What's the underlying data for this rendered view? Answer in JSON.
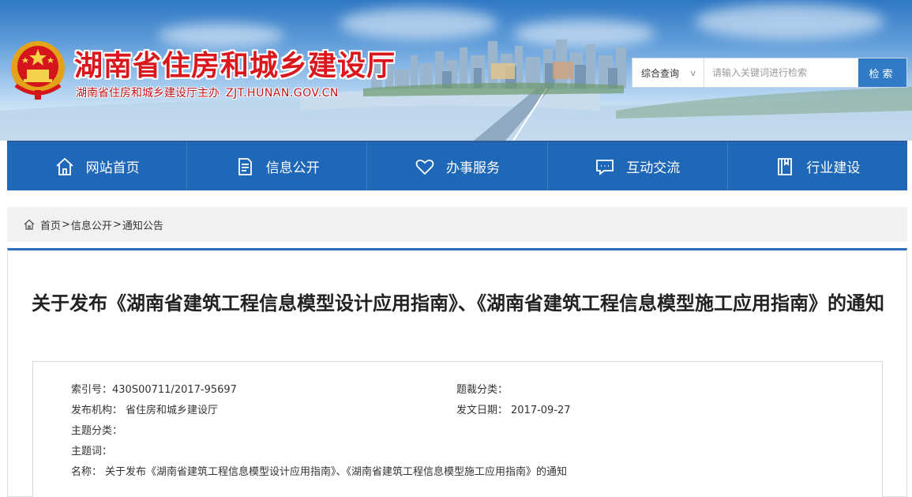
{
  "header": {
    "site_title": "湖南省住房和城乡建设厅",
    "subtitle": "湖南省住房和城乡建设厅主办",
    "domain": "ZJT.HUNAN.GOV.CN"
  },
  "search": {
    "category": "综合查询",
    "category_arrow": "v",
    "placeholder": "请输入关键词进行检索",
    "button": "检索"
  },
  "nav": {
    "items": [
      {
        "label": "网站首页",
        "icon": "home-icon"
      },
      {
        "label": "信息公开",
        "icon": "document-icon"
      },
      {
        "label": "办事服务",
        "icon": "heart-icon"
      },
      {
        "label": "互动交流",
        "icon": "chat-icon"
      },
      {
        "label": "行业建设",
        "icon": "book-icon"
      }
    ]
  },
  "breadcrumb": {
    "items": [
      "首页",
      "信息公开",
      "通知公告"
    ],
    "separator": ">"
  },
  "article": {
    "title": "关于发布《湖南省建筑工程信息模型设计应用指南》、《湖南省建筑工程信息模型施工应用指南》的通知"
  },
  "meta": {
    "index_label": "索引号：",
    "index_value": "430S00711/2017-95697",
    "genre_label": "题裁分类：",
    "genre_value": "",
    "issuer_label": "发布机构：",
    "issuer_value": "省住房和城乡建设厅",
    "date_label": "发文日期：",
    "date_value": "2017-09-27",
    "topic_label": "主题分类：",
    "topic_value": "",
    "keywords_label": "主题词：",
    "keywords_value": "",
    "name_label": "名称：",
    "name_value": "关于发布《湖南省建筑工程信息模型设计应用指南》、《湖南省建筑工程信息模型施工应用指南》的通知"
  },
  "colors": {
    "nav_bg": "#1f68b7",
    "title_red": "#d9171d",
    "search_button": "#2f7bc6"
  }
}
